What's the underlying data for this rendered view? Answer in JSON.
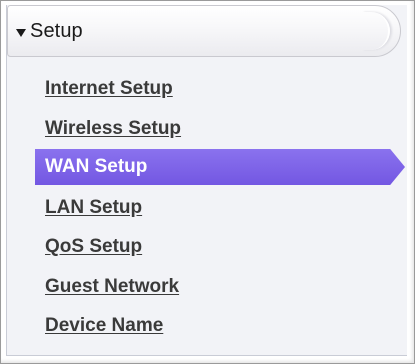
{
  "section": {
    "title": "Setup"
  },
  "menu": {
    "items": [
      {
        "label": "Internet Setup"
      },
      {
        "label": "Wireless Setup"
      },
      {
        "label": "WAN Setup",
        "active": true
      },
      {
        "label": "LAN Setup"
      },
      {
        "label": "QoS Setup"
      },
      {
        "label": "Guest Network"
      },
      {
        "label": "Device Name"
      }
    ]
  },
  "colors": {
    "active_bg": "#7357e2",
    "active_text": "#ffffff",
    "link_text": "#3a3a3a",
    "panel_bg": "#f2f3f7"
  }
}
